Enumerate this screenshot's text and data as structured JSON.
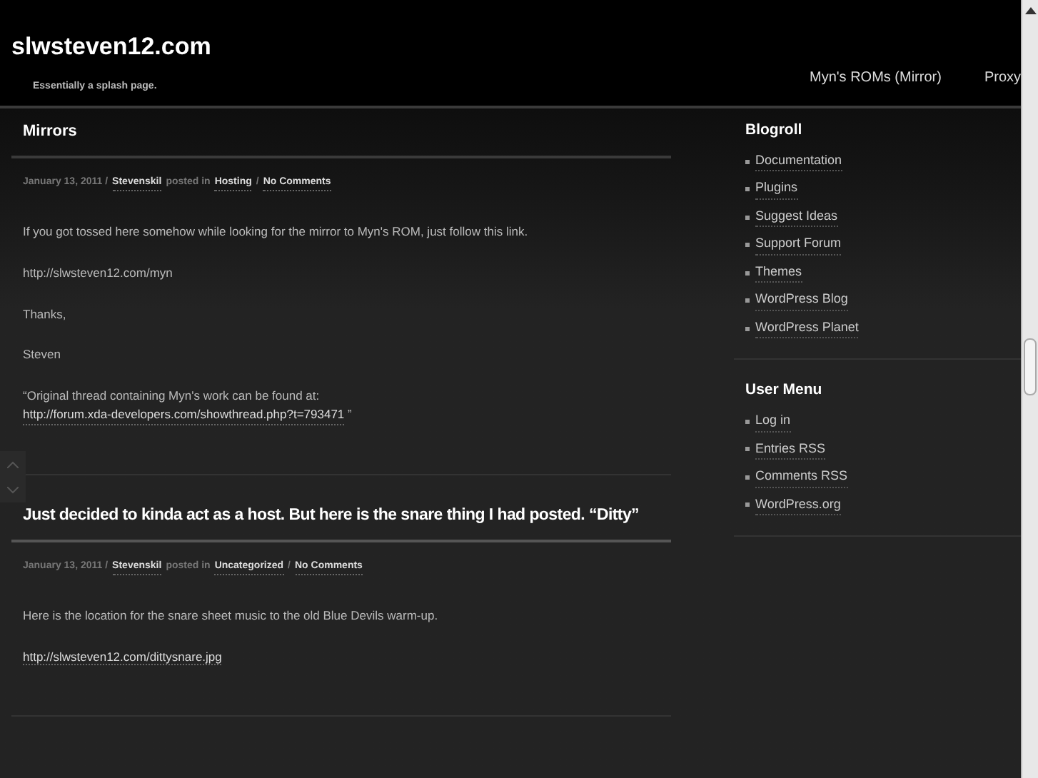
{
  "site": {
    "title": "slwsteven12.com",
    "tagline": "Essentially a splash page."
  },
  "nav": [
    {
      "label": "Myn's ROMs (Mirror)"
    },
    {
      "label": "Proxy"
    }
  ],
  "posts": [
    {
      "title": "Mirrors",
      "meta": [
        {
          "kind": "text",
          "text": "January 13, 2011 /"
        },
        {
          "kind": "link",
          "text": "Stevenskil"
        },
        {
          "kind": "text",
          "text": "posted in"
        },
        {
          "kind": "link",
          "text": "Hosting"
        },
        {
          "kind": "text",
          "text": "/"
        },
        {
          "kind": "link",
          "text": "No Comments"
        }
      ],
      "paragraphs": [
        [
          {
            "kind": "text",
            "text": "If you got tossed here somehow while looking for the mirror to Myn's ROM, just follow this link."
          }
        ],
        [
          {
            "kind": "text",
            "text": "http://slwsteven12.com/myn"
          }
        ],
        [
          {
            "kind": "text",
            "text": "Thanks,"
          }
        ],
        [
          {
            "kind": "text",
            "text": "Steven"
          }
        ],
        [
          {
            "kind": "text",
            "text": "“Original thread containing Myn's work can be found at:"
          },
          {
            "kind": "link",
            "text": "http://forum.xda-developers.com/showthread.php?t=793471"
          },
          {
            "kind": "text",
            "text": "”"
          }
        ]
      ]
    },
    {
      "title": "Just decided to kinda act as a host. But here is the snare thing I had posted. “Ditty”",
      "meta": [
        {
          "kind": "text",
          "text": "January 13, 2011 /"
        },
        {
          "kind": "link",
          "text": "Stevenskil"
        },
        {
          "kind": "text",
          "text": "posted in"
        },
        {
          "kind": "link",
          "text": "Uncategorized"
        },
        {
          "kind": "text",
          "text": "/"
        },
        {
          "kind": "link",
          "text": "No Comments"
        }
      ],
      "paragraphs": [
        [
          {
            "kind": "text",
            "text": "Here is the location for the snare sheet music to the old Blue Devils warm-up."
          }
        ],
        [
          {
            "kind": "link",
            "text": "http://slwsteven12.com/dittysnare.jpg"
          }
        ]
      ]
    }
  ],
  "sidebar": [
    {
      "title": "Blogroll",
      "items": [
        "Documentation",
        "Plugins",
        "Suggest Ideas",
        "Support Forum",
        "Themes",
        "WordPress Blog",
        "WordPress Planet"
      ]
    },
    {
      "title": "User Menu",
      "items": [
        "Log in",
        "Entries RSS",
        "Comments RSS",
        "WordPress.org"
      ]
    }
  ]
}
